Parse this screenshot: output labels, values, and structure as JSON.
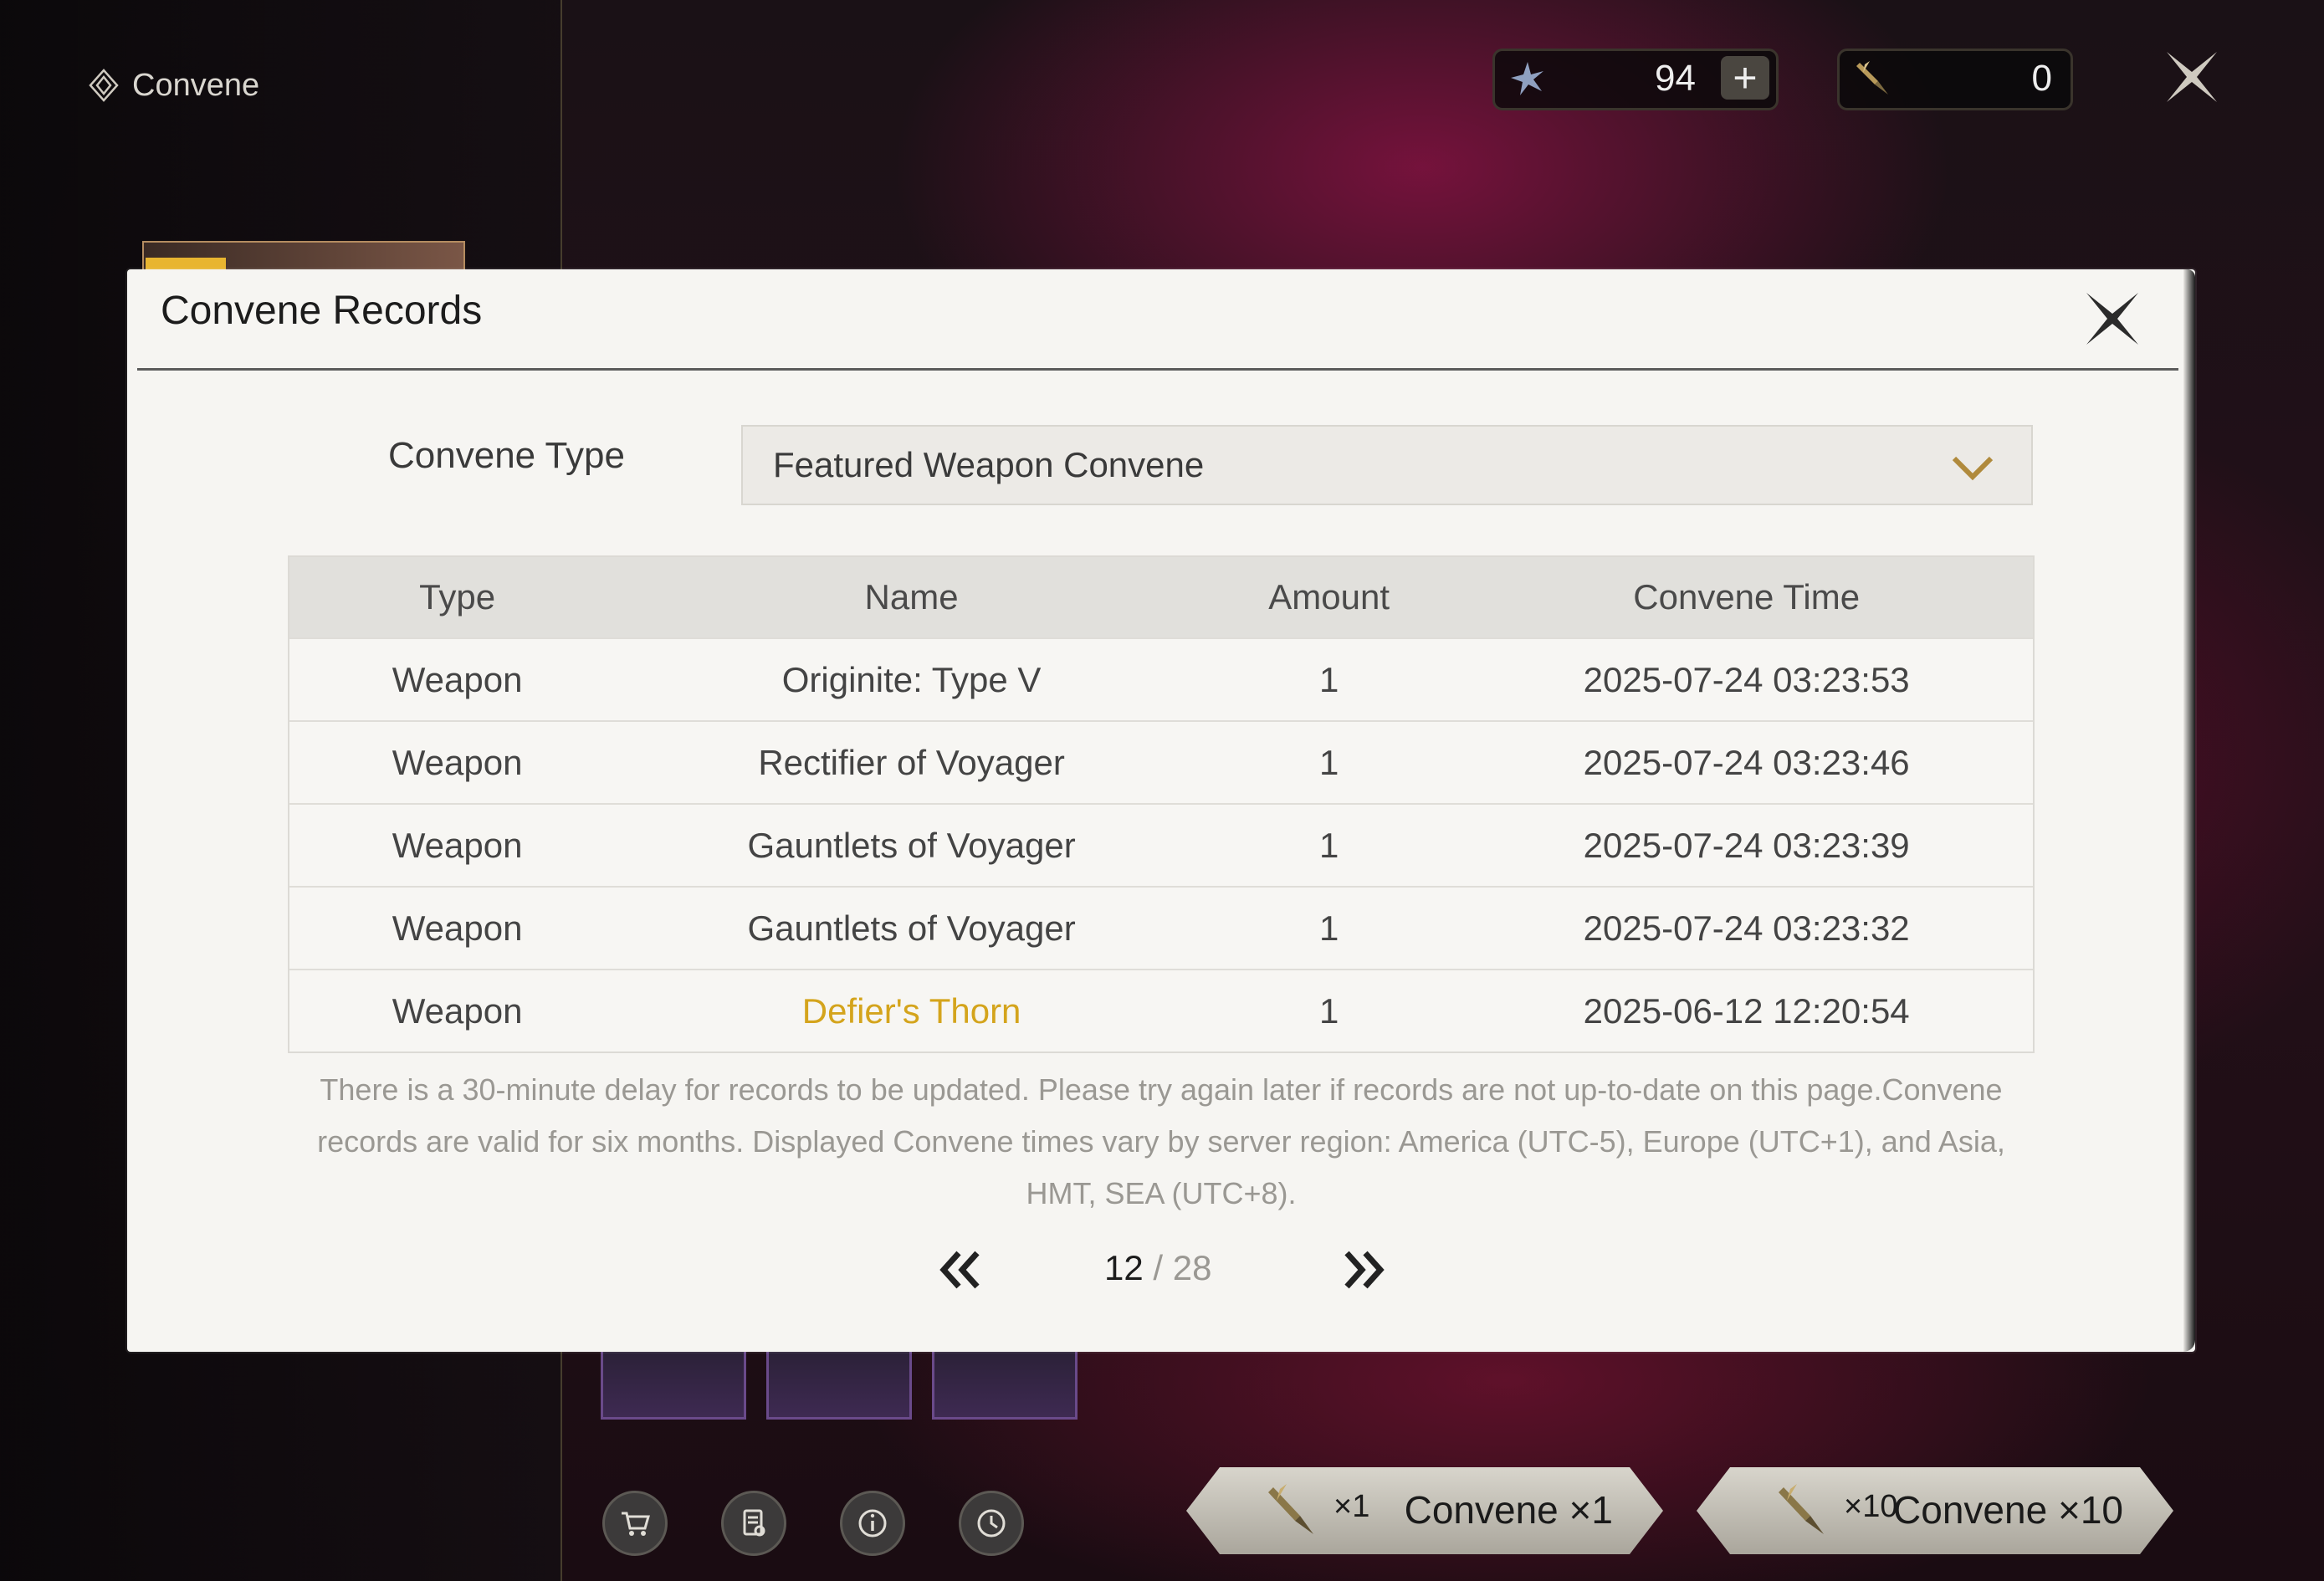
{
  "app": {
    "title": "Convene"
  },
  "currencies": [
    {
      "icon": "astrite-icon",
      "value": "94",
      "add_label": "+"
    },
    {
      "icon": "forging-tide-icon",
      "value": "0"
    }
  ],
  "pull_buttons": {
    "single": {
      "count": "×1",
      "label": "Convene ×1"
    },
    "ten": {
      "count": "×10",
      "label": "Convene ×10"
    }
  },
  "bottom_icons": [
    "cart-icon",
    "details-icon",
    "info-icon",
    "history-icon"
  ],
  "dialog": {
    "title": "Convene Records",
    "convene_type_label": "Convene Type",
    "convene_type_value": "Featured Weapon Convene",
    "table": {
      "headers": [
        "Type",
        "Name",
        "Amount",
        "Convene Time"
      ],
      "rows": [
        {
          "type": "Weapon",
          "name": "Originite: Type V",
          "amount": "1",
          "time": "2025-07-24 03:23:53",
          "rarity": "normal"
        },
        {
          "type": "Weapon",
          "name": "Rectifier of Voyager",
          "amount": "1",
          "time": "2025-07-24 03:23:46",
          "rarity": "normal"
        },
        {
          "type": "Weapon",
          "name": "Gauntlets of Voyager",
          "amount": "1",
          "time": "2025-07-24 03:23:39",
          "rarity": "normal"
        },
        {
          "type": "Weapon",
          "name": "Gauntlets of Voyager",
          "amount": "1",
          "time": "2025-07-24 03:23:32",
          "rarity": "normal"
        },
        {
          "type": "Weapon",
          "name": "Defier's Thorn",
          "amount": "1",
          "time": "2025-06-12 12:20:54",
          "rarity": "gold"
        }
      ]
    },
    "note": "There is a 30-minute delay for records to be updated. Please try again later if records are not up-to-date on this page.Convene records are valid for six months. Displayed Convene times vary by server region: America (UTC-5), Europe (UTC+1), and Asia, HMT, SEA (UTC+8).",
    "pagination": {
      "current": "12",
      "separator": "/",
      "total": "28"
    }
  },
  "colors": {
    "accent_gold": "#d4a41c",
    "dialog_bg": "#f6f5f2",
    "chevron": "#b08a3c"
  }
}
